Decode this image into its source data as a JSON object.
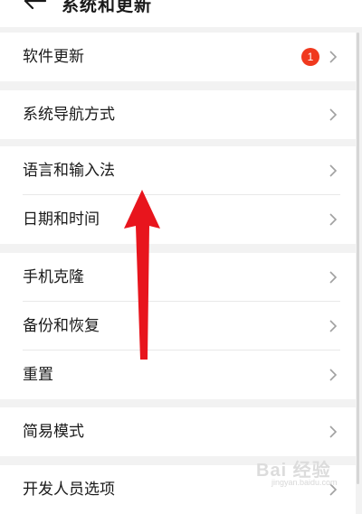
{
  "header": {
    "title": "系统和更新",
    "back_icon": "arrow-left-icon"
  },
  "groups": [
    {
      "items": [
        {
          "label": "软件更新",
          "badge": "1"
        }
      ]
    },
    {
      "items": [
        {
          "label": "系统导航方式"
        }
      ]
    },
    {
      "items": [
        {
          "label": "语言和输入法"
        },
        {
          "label": "日期和时间"
        }
      ]
    },
    {
      "items": [
        {
          "label": "手机克隆"
        },
        {
          "label": "备份和恢复"
        },
        {
          "label": "重置"
        }
      ]
    },
    {
      "items": [
        {
          "label": "简易模式"
        }
      ]
    },
    {
      "items": [
        {
          "label": "开发人员选项"
        }
      ]
    }
  ],
  "annotation": {
    "icon": "red-arrow-up-icon",
    "color": "#e8151d"
  },
  "watermark": {
    "text": "Bai 经验",
    "subtext": "jingyan.baidu.com"
  },
  "colors": {
    "badge": "#f0391e",
    "background": "#f2f2f2",
    "card": "#ffffff",
    "chevron": "#a0a0a0"
  }
}
